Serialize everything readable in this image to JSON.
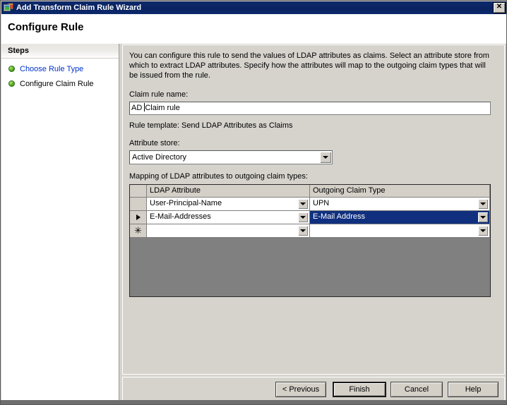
{
  "window": {
    "title": "Add Transform Claim Rule Wizard",
    "title_icon": "wizard-icon",
    "close_label": "✕"
  },
  "header": {
    "title": "Configure Rule"
  },
  "sidebar": {
    "header": "Steps",
    "items": [
      {
        "label": "Choose Rule Type",
        "state": "link"
      },
      {
        "label": "Configure Claim Rule",
        "state": "current"
      }
    ]
  },
  "main": {
    "intro": "You can configure this rule to send the values of LDAP attributes as claims. Select an attribute store from which to extract LDAP attributes. Specify how the attributes will map to the outgoing claim types that will be issued from the rule.",
    "claim_rule_name_label": "Claim rule name:",
    "claim_rule_name_value_before_caret": "AD ",
    "claim_rule_name_value_after_caret": "Claim rule",
    "claim_rule_name_value": "AD Claim rule",
    "rule_template_text": "Rule template: Send LDAP Attributes as Claims",
    "attribute_store_label": "Attribute store:",
    "attribute_store_value": "Active Directory",
    "grid_caption": "Mapping of LDAP attributes to outgoing claim types:",
    "grid": {
      "columns": [
        "LDAP Attribute",
        "Outgoing Claim Type"
      ],
      "rows": [
        {
          "marker": "",
          "ldap_attribute": "User-Principal-Name",
          "outgoing_claim_type": "UPN",
          "selected": false
        },
        {
          "marker": "arrow",
          "ldap_attribute": "E-Mail-Addresses",
          "outgoing_claim_type": "E-Mail Address",
          "selected": true
        },
        {
          "marker": "star",
          "ldap_attribute": "",
          "outgoing_claim_type": "",
          "selected": false
        }
      ]
    }
  },
  "footer": {
    "previous": "< Previous",
    "finish": "Finish",
    "cancel": "Cancel",
    "help": "Help"
  },
  "colors": {
    "titlebar": "#0a2260",
    "dialog_face": "#d6d3cd",
    "selection": "#10307f",
    "link": "#0033cc",
    "step_bullet": "#63b82a",
    "grid_empty": "#808080"
  }
}
